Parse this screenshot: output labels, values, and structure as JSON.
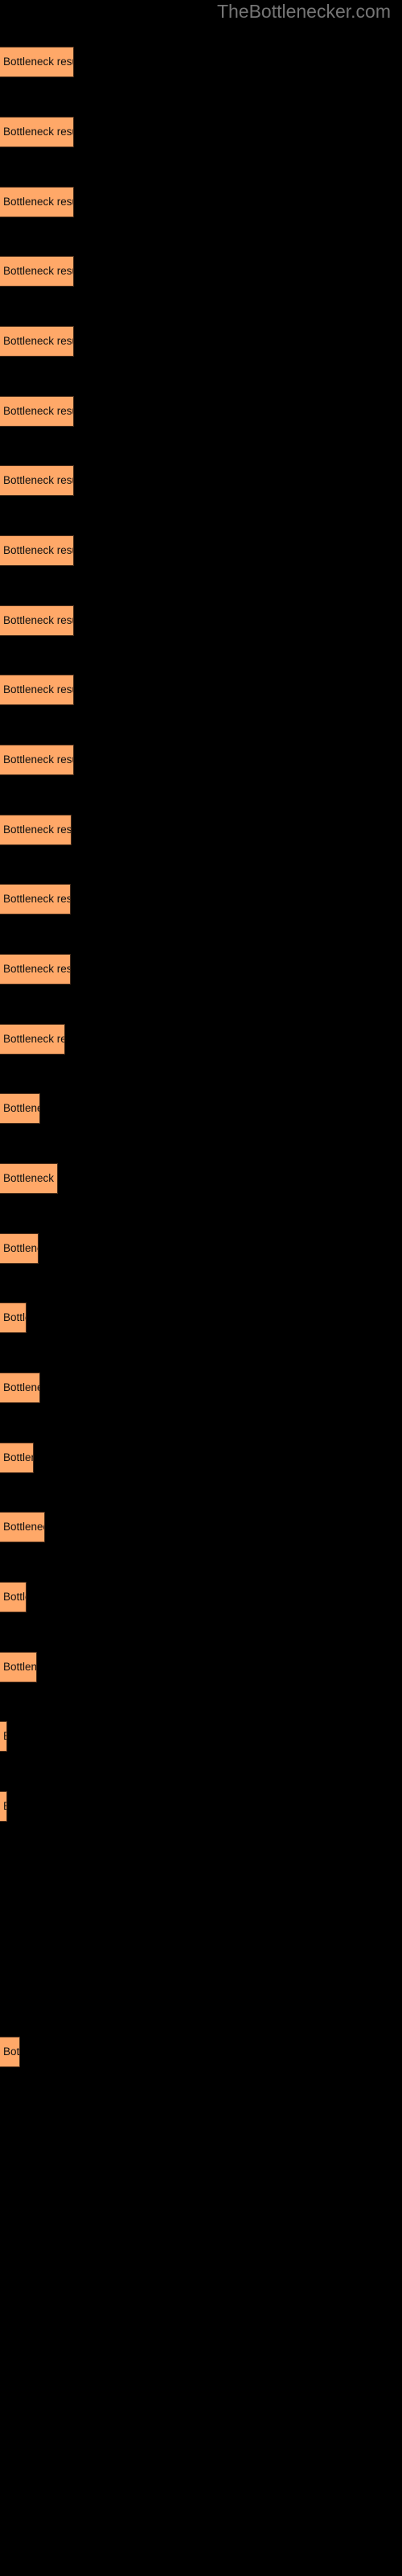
{
  "site": {
    "watermark": "TheBottlenecker.com"
  },
  "colors": {
    "background": "#000000",
    "bar_fill": "#ffa868",
    "bar_border": "#4a2d1a",
    "bar_label_text": "#111111",
    "watermark_text": "#757575"
  },
  "chart_data": {
    "type": "bar",
    "orientation": "horizontal",
    "title": "",
    "subtitle": "",
    "xlabel": "",
    "ylabel": "",
    "grid": false,
    "legend": false,
    "bar_label_text": "Bottleneck result",
    "categories": [
      "Bottleneck result",
      "Bottleneck result",
      "Bottleneck result",
      "Bottleneck result",
      "Bottleneck result",
      "Bottleneck result",
      "Bottleneck result",
      "Bottleneck result",
      "Bottleneck result",
      "Bottleneck result",
      "Bottleneck result",
      "Bottleneck result",
      "Bottleneck result",
      "Bottleneck result",
      "Bottleneck result",
      "Bottleneck result",
      "Bottleneck result",
      "Bottleneck result",
      "Bottleneck result",
      "Bottleneck result",
      "Bottleneck result",
      "Bottleneck result",
      "Bottleneck result",
      "Bottleneck result",
      "Bottleneck result",
      "Bottleneck result",
      "Bottleneck result"
    ],
    "values": [
      92,
      92,
      92,
      92,
      92,
      92,
      92,
      92,
      92,
      92,
      92,
      92,
      92,
      92,
      81,
      50,
      72,
      48,
      33,
      50,
      42,
      56,
      33,
      46,
      14,
      14,
      25
    ],
    "xlim": [
      0,
      500
    ],
    "bars": [
      {
        "y": 58,
        "width": 92,
        "label": "Bottleneck result"
      },
      {
        "y": 145,
        "width": 92,
        "label": "Bottleneck result"
      },
      {
        "y": 232,
        "width": 92,
        "label": "Bottleneck result"
      },
      {
        "y": 318,
        "width": 92,
        "label": "Bottleneck result"
      },
      {
        "y": 405,
        "width": 92,
        "label": "Bottleneck result"
      },
      {
        "y": 492,
        "width": 92,
        "label": "Bottleneck result"
      },
      {
        "y": 578,
        "width": 92,
        "label": "Bottleneck result"
      },
      {
        "y": 665,
        "width": 92,
        "label": "Bottleneck result"
      },
      {
        "y": 752,
        "width": 92,
        "label": "Bottleneck result"
      },
      {
        "y": 838,
        "width": 92,
        "label": "Bottleneck result"
      },
      {
        "y": 925,
        "width": 92,
        "label": "Bottleneck result"
      },
      {
        "y": 1012,
        "width": 89,
        "label": "Bottleneck result"
      },
      {
        "y": 1098,
        "width": 88,
        "label": "Bottleneck result"
      },
      {
        "y": 1185,
        "width": 88,
        "label": "Bottleneck result"
      },
      {
        "y": 1272,
        "width": 81,
        "label": "Bottleneck result"
      },
      {
        "y": 1358,
        "width": 50,
        "label": "Bottleneck result"
      },
      {
        "y": 1445,
        "width": 72,
        "label": "Bottleneck result"
      },
      {
        "y": 1532,
        "width": 48,
        "label": "Bottleneck result"
      },
      {
        "y": 1618,
        "width": 33,
        "label": "Bottleneck result"
      },
      {
        "y": 1705,
        "width": 50,
        "label": "Bottleneck result"
      },
      {
        "y": 1792,
        "width": 42,
        "label": "Bottleneck result"
      },
      {
        "y": 1878,
        "width": 56,
        "label": "Bottleneck result"
      },
      {
        "y": 1965,
        "width": 33,
        "label": "Bottleneck result"
      },
      {
        "y": 2052,
        "width": 46,
        "label": "Bottleneck result"
      },
      {
        "y": 2138,
        "width": 9,
        "label": "Bottleneck result"
      },
      {
        "y": 2225,
        "width": 9,
        "label": "Bottleneck result"
      },
      {
        "y": 2530,
        "width": 25,
        "label": "Bottleneck result"
      }
    ]
  }
}
